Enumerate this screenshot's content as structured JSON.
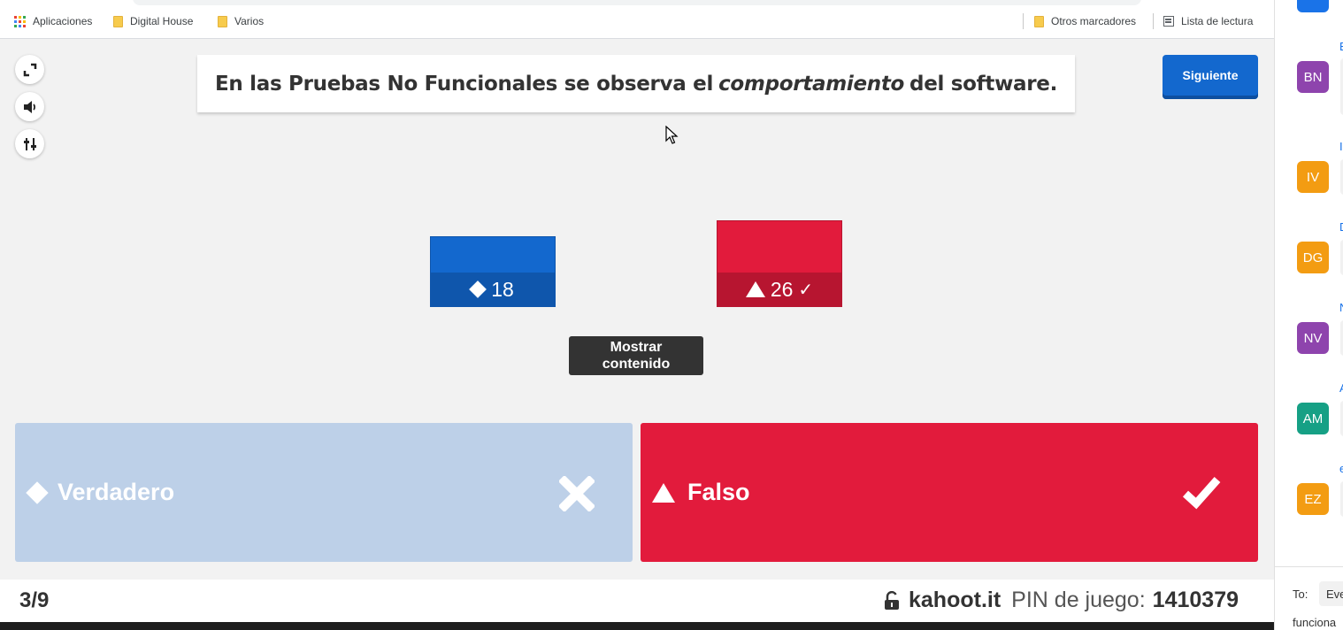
{
  "bookmarks": {
    "apps": "Aplicaciones",
    "items": [
      "Digital House",
      "Varios"
    ],
    "other": "Otros marcadores",
    "reading_list": "Lista de lectura"
  },
  "game": {
    "question_before": "En las Pruebas No Funcionales se observa el",
    "question_emphasis": "comportamiento",
    "question_after": "del software.",
    "next_label": "Siguiente",
    "results": [
      {
        "shape": "diamond",
        "count": "18",
        "correct": false
      },
      {
        "shape": "triangle",
        "count": "26",
        "correct": true
      }
    ],
    "correct_mark": "✓",
    "show_content_label": "Mostrar contenido",
    "answers": [
      {
        "shape": "diamond",
        "label": "Verdadero",
        "correct": false
      },
      {
        "shape": "triangle",
        "label": "Falso",
        "correct": true
      }
    ],
    "colors": {
      "blue": "#1368ce",
      "red": "#e21b3c",
      "faded_blue": "#bdd0e8"
    }
  },
  "footer": {
    "progress": "3/9",
    "site": "kahoot.it",
    "pin_label": "PIN de juego:",
    "pin_value": "1410379"
  },
  "chat": {
    "avatars": [
      {
        "initials": "BN",
        "color": "#8e44ad"
      },
      {
        "initials": "IV",
        "color": "#f39c12"
      },
      {
        "initials": "DG",
        "color": "#f39c12"
      },
      {
        "initials": "NV",
        "color": "#8e44ad"
      },
      {
        "initials": "AM",
        "color": "#16a085"
      },
      {
        "initials": "EZ",
        "color": "#f39c12"
      }
    ],
    "name_initials": [
      "E",
      "I",
      "D",
      "N",
      "A",
      "e"
    ],
    "to_label": "To:",
    "to_chip": "Eve",
    "draft": "funciona"
  }
}
